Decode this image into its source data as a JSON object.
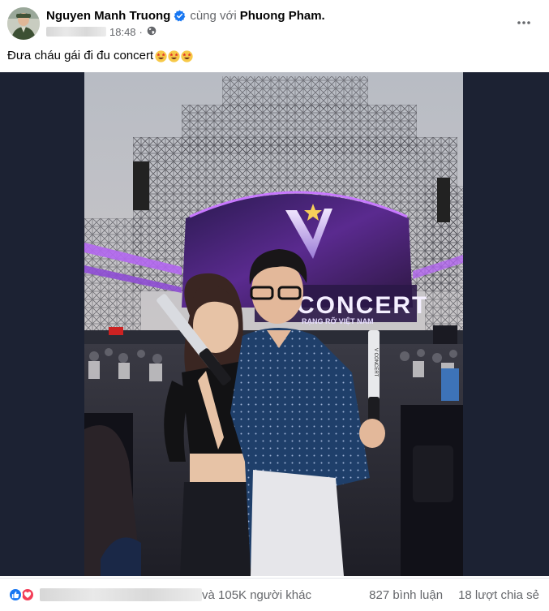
{
  "post": {
    "author": "Nguyen Manh Truong",
    "with_text": "cùng với",
    "with_name": "Phuong Pham.",
    "time": "18:48",
    "dot": "·",
    "caption": "Đưa cháu gái đi đu concert",
    "caption_emoji": [
      "star-struck-emoji",
      "star-struck-emoji",
      "star-struck-emoji"
    ],
    "photo": {
      "stage_logo": "V",
      "stage_text": "CONCERT",
      "stage_subtext": "RẠNG RỠ VIỆT NAM",
      "lightstick_text": "V CONCERT"
    }
  },
  "footer": {
    "reactions": [
      "like",
      "love"
    ],
    "reaction_count": "và 105K người khác",
    "comments": "827 bình luận",
    "shares": "18 lượt chia sẻ"
  },
  "colors": {
    "facebook_blue": "#1877f2",
    "love_red": "#f33e58",
    "secondary_text": "#65676b",
    "media_bg": "#1c2233"
  }
}
